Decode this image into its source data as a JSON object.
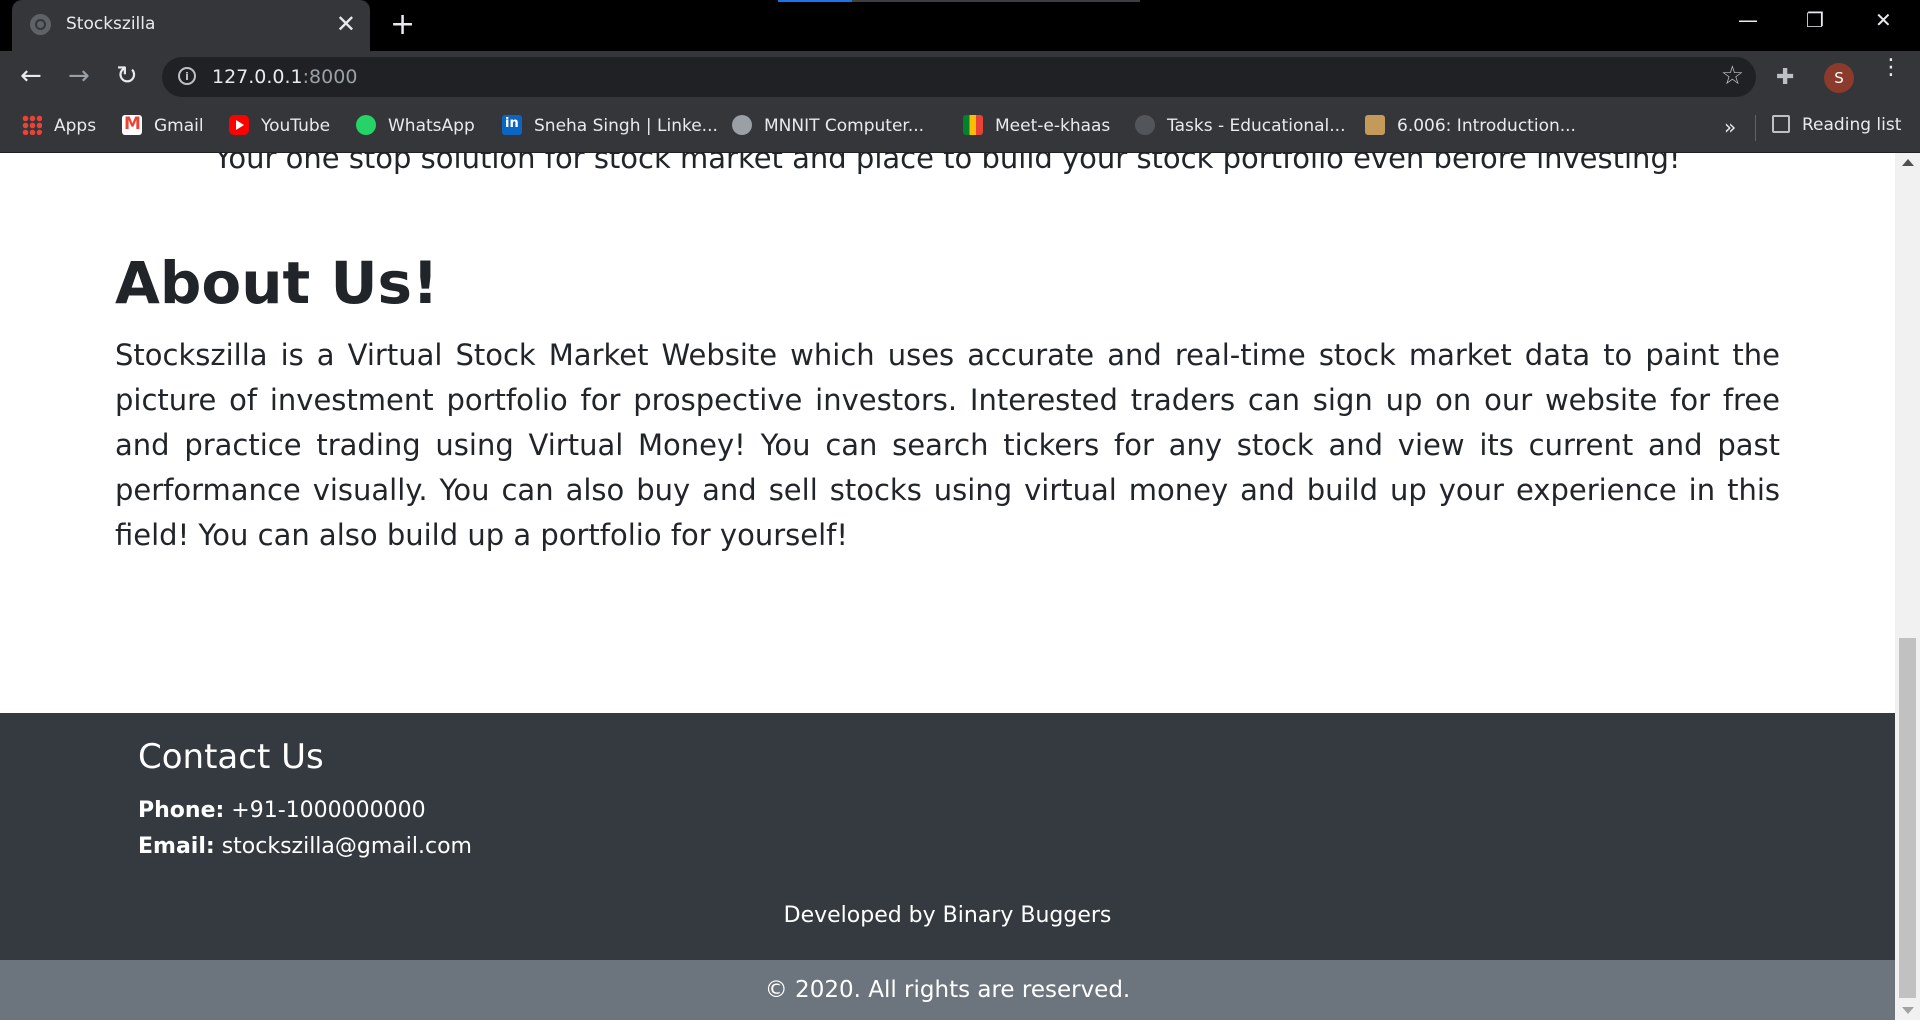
{
  "browser": {
    "tab": {
      "title": "Stockszilla",
      "close": "✕"
    },
    "new_tab": "+",
    "window_controls": {
      "minimize": "—",
      "restore": "❐",
      "close": "✕"
    },
    "nav": {
      "back": "←",
      "forward": "→",
      "reload": "↻"
    },
    "address": {
      "host": "127.0.0.1",
      "port": ":8000"
    },
    "bookmark_star": "☆",
    "extensions_icon": "puzzle-icon",
    "profile_initial": "S",
    "menu": "⋮",
    "bookmarks": [
      {
        "label": "Apps",
        "icon": "apps-icon"
      },
      {
        "label": "Gmail",
        "icon": "gmail-icon"
      },
      {
        "label": "YouTube",
        "icon": "youtube-icon"
      },
      {
        "label": "WhatsApp",
        "icon": "whatsapp-icon"
      },
      {
        "label": "Sneha Singh | Linke...",
        "icon": "linkedin-icon"
      },
      {
        "label": "MNNIT Computer...",
        "icon": "globe-icon"
      },
      {
        "label": "Meet-e-khaas",
        "icon": "meet-icon"
      },
      {
        "label": "Tasks - Educational...",
        "icon": "tasks-icon"
      },
      {
        "label": "6.006: Introduction...",
        "icon": "mit-icon"
      }
    ],
    "bookmarks_more": "»",
    "reading_list": "Reading list"
  },
  "page": {
    "tagline": "Your one stop solution for stock market and place to build your stock portfolio even before investing!",
    "about": {
      "title": "About Us!",
      "text": "Stockszilla is a Virtual Stock Market Website which uses accurate and real-time stock market data to paint the picture of investment portfolio for prospective investors. Interested traders can sign up on our website for free and practice trading using Virtual Money! You can search tickers for any stock and view its current and past performance visually. You can also buy and sell stocks using virtual money and build up your experience in this field! You can also build up a portfolio for yourself!"
    },
    "footer": {
      "contact_title": "Contact Us",
      "phone_label": "Phone:",
      "phone": "+91-1000000000",
      "email_label": "Email:",
      "email": "stockszilla@gmail.com",
      "developed_by": "Developed by Binary Buggers",
      "copyright": "© 2020. All rights are reserved."
    }
  },
  "colors": {
    "footer_bg": "#343a40",
    "copyright_bg": "#6c757d",
    "browser_dark": "#35363a"
  }
}
